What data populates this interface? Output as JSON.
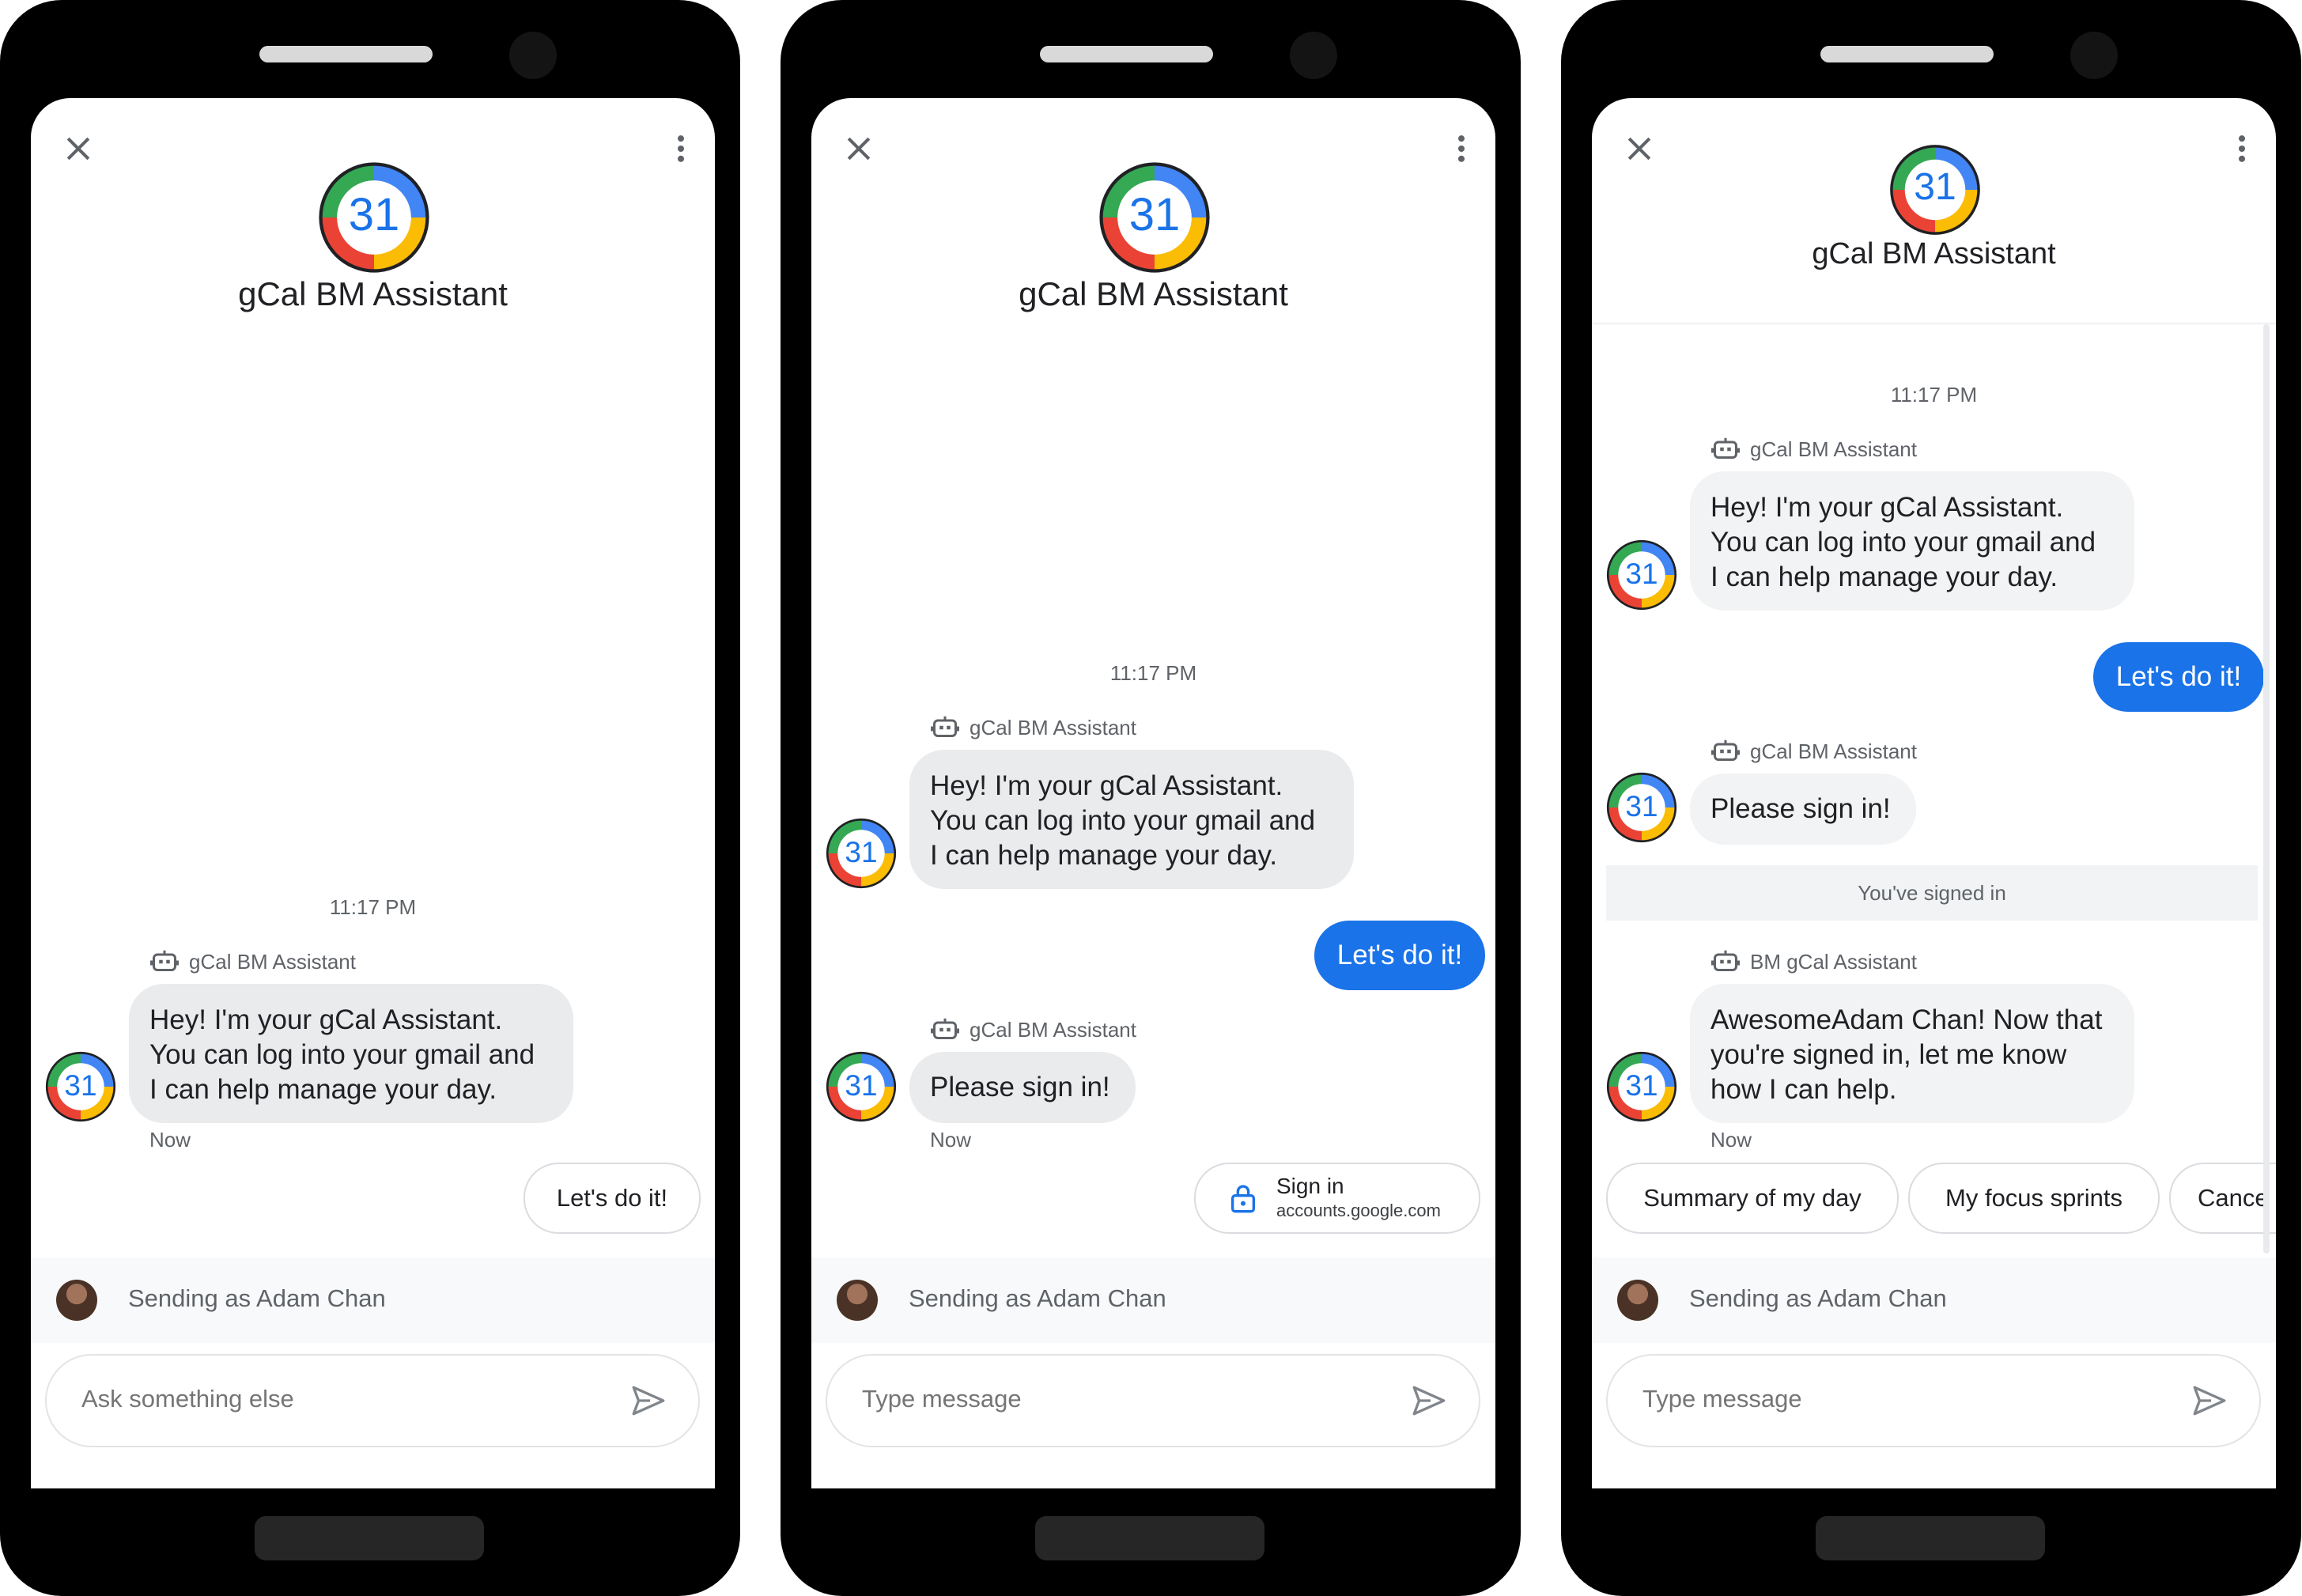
{
  "agent": {
    "name": "gCal BM Assistant",
    "logo_text": "31",
    "logo_colors": [
      "#4285F4",
      "#EA4335",
      "#FBBC04",
      "#34A853"
    ]
  },
  "timestamp": "11:17 PM",
  "sending_as": "Sending as Adam Chan",
  "colors": {
    "user_bubble": "#1a73e8",
    "agent_bubble": "#e9ebed",
    "chip_border": "#dadce0"
  },
  "screens": [
    {
      "sender_label": "gCal BM Assistant",
      "greeting": "Hey! I'm your gCal Assistant.\nYou can log into your gmail and\nI can help manage your day.",
      "now": "Now",
      "suggestion_chip": "Let's do it!",
      "input_placeholder": "Ask something else"
    },
    {
      "sender_label_1": "gCal BM Assistant",
      "greeting": "Hey! I'm your gCal Assistant.\nYou can log into your gmail and\nI can help manage your day.",
      "user_reply": "Let's do it!",
      "sender_label_2": "gCal BM Assistant",
      "sign_in_prompt": "Please sign in!",
      "now": "Now",
      "signin_chip": {
        "title": "Sign in",
        "subtitle": "accounts.google.com"
      },
      "input_placeholder": "Type message"
    },
    {
      "sender_label_1": "gCal BM Assistant",
      "greeting": "Hey! I'm your gCal Assistant.\nYou can log into your gmail and\nI can help manage your day.",
      "user_reply": "Let's do it!",
      "sender_label_2": "gCal BM Assistant",
      "sign_in_prompt": "Please sign in!",
      "system_event": "You've signed in",
      "sender_label_3": "BM gCal Assistant",
      "signed_in_message": "AwesomeAdam Chan! Now that\nyou're signed in, let me know\nhow I can help.",
      "now": "Now",
      "chips": [
        "Summary of my day",
        "My focus sprints",
        "Cance"
      ],
      "input_placeholder": "Type message"
    }
  ]
}
